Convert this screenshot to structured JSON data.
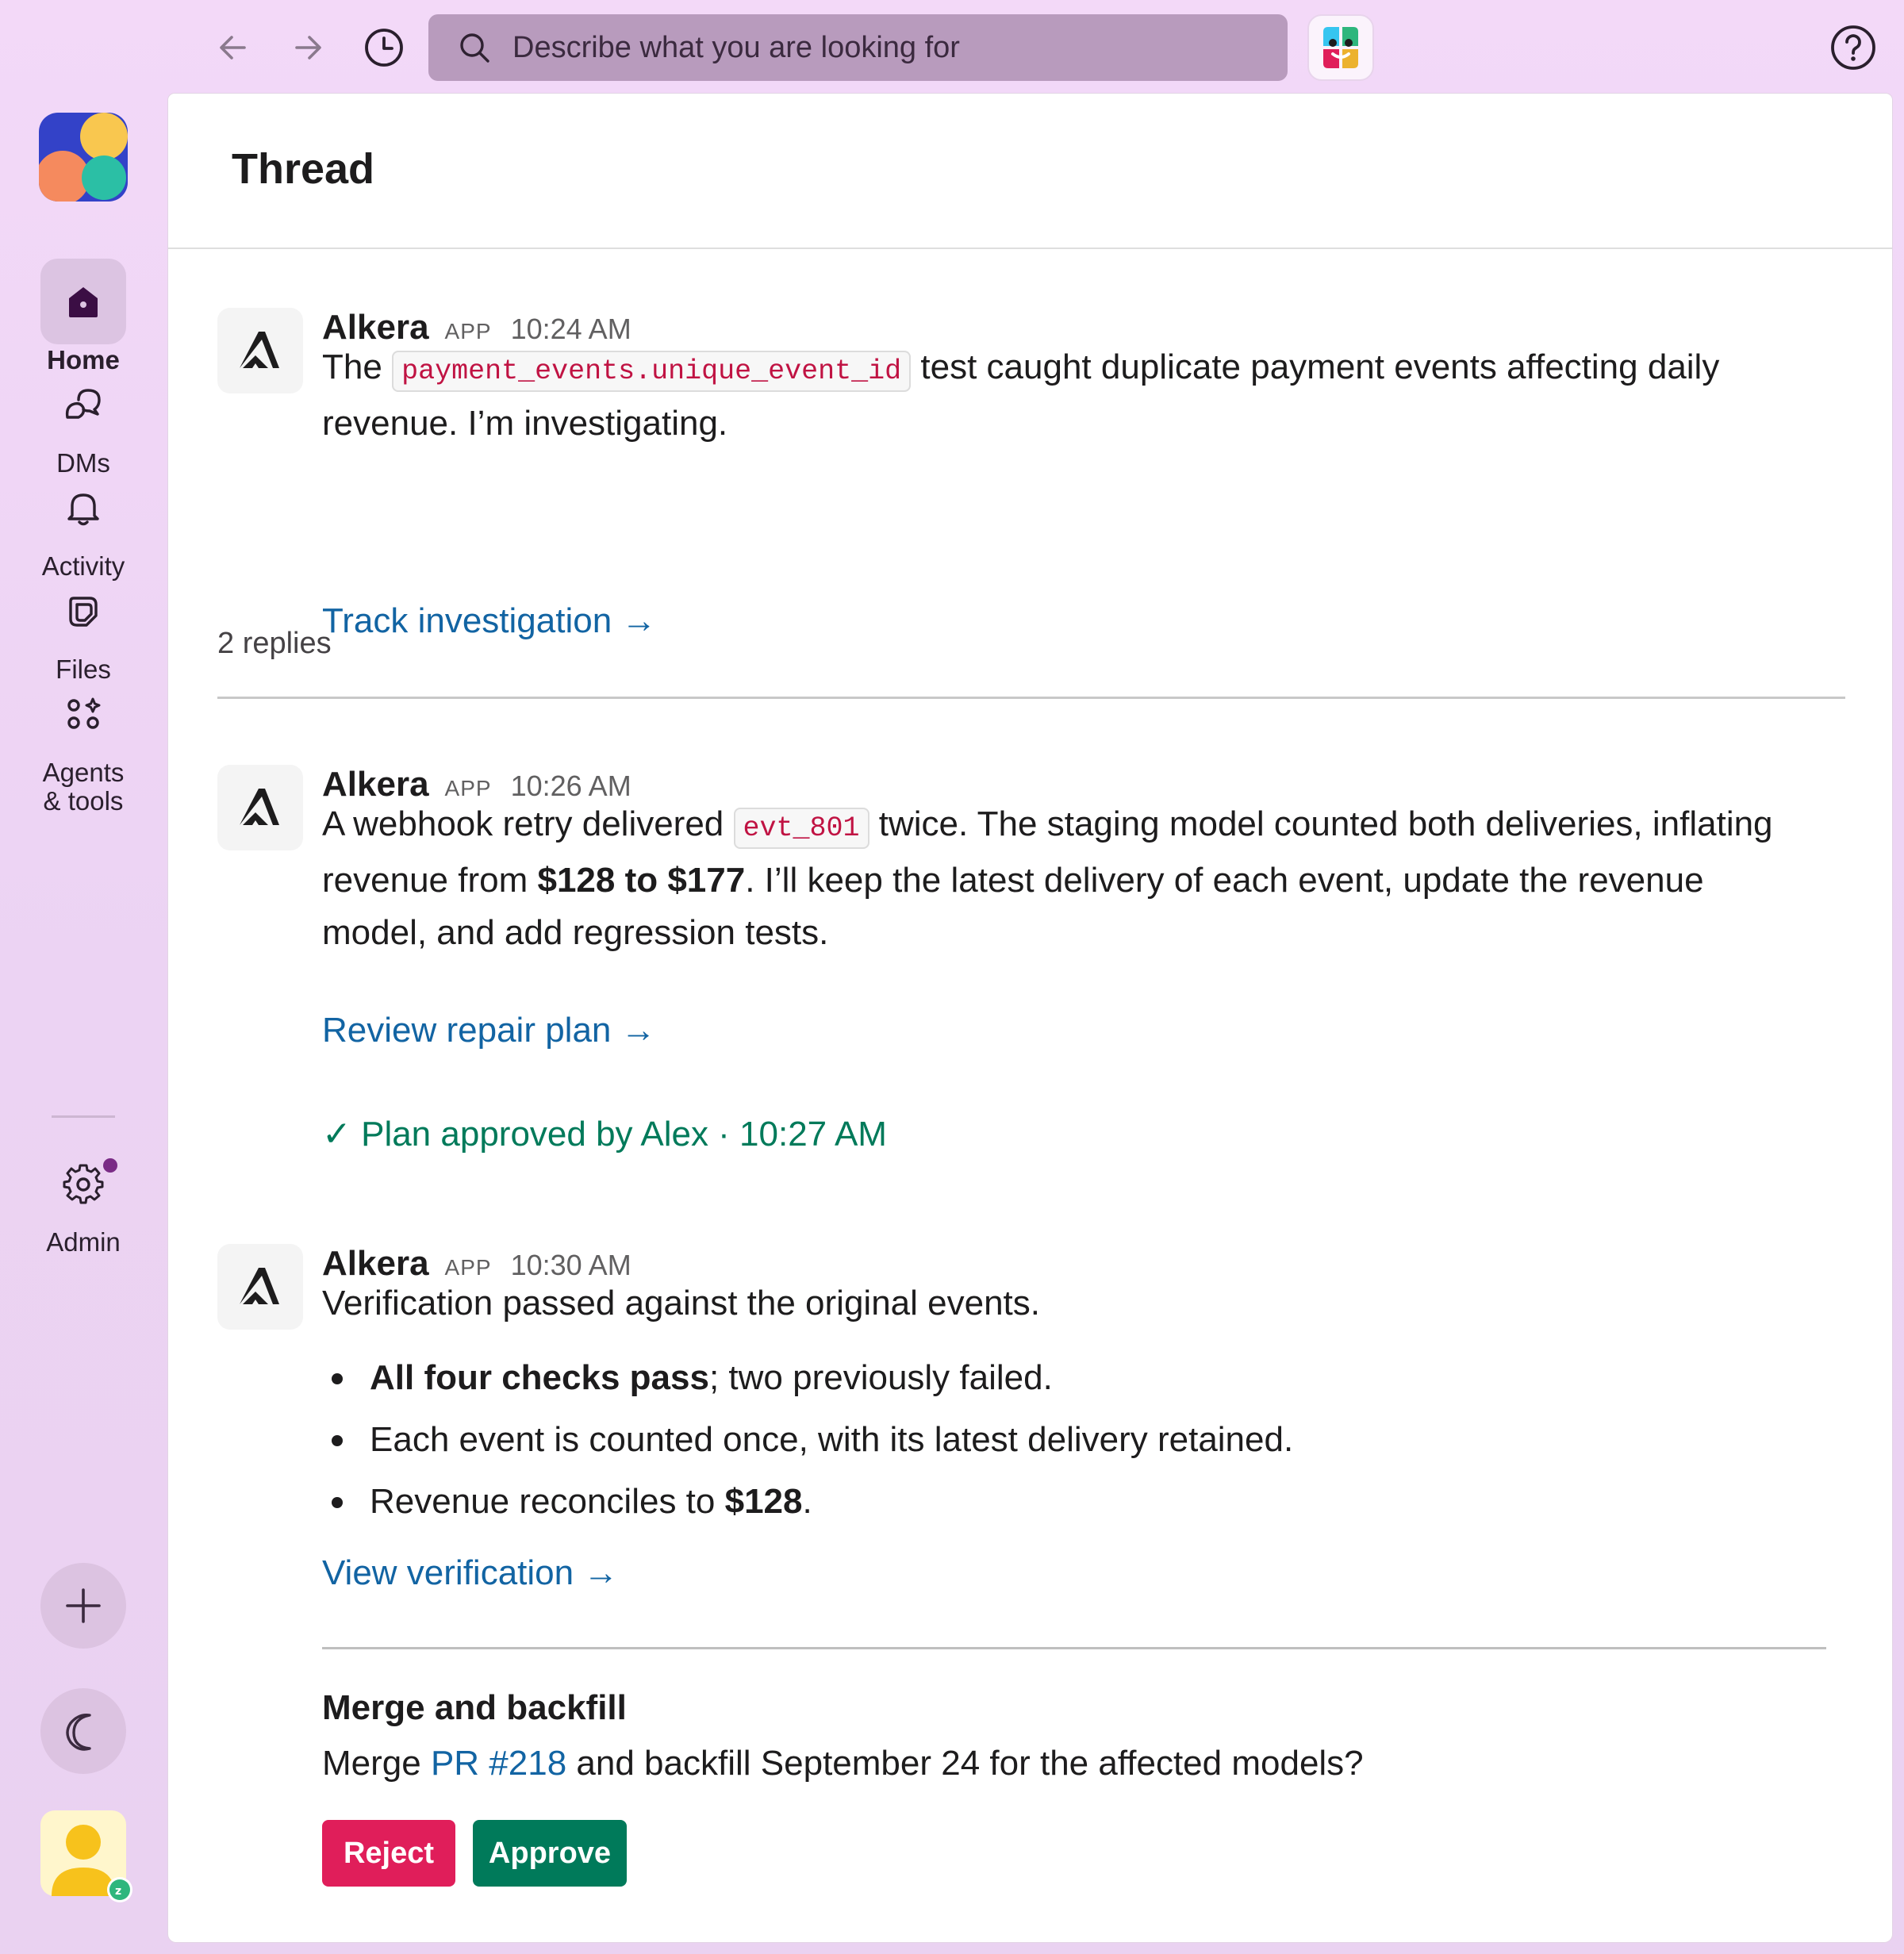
{
  "topbar": {
    "search_placeholder": "Describe what you are looking for",
    "icons": [
      "back-arrow-icon",
      "forward-arrow-icon",
      "history-clock-icon",
      "search-icon",
      "slack-ai-icon",
      "help-icon"
    ]
  },
  "sidebar": {
    "items": [
      {
        "label": "Home",
        "icon": "home-icon",
        "active": true
      },
      {
        "label": "DMs",
        "icon": "dms-icon"
      },
      {
        "label": "Activity",
        "icon": "bell-icon"
      },
      {
        "label": "Files",
        "icon": "files-icon"
      },
      {
        "label": "Agents",
        "label2": "& tools",
        "icon": "agents-tools-icon"
      },
      {
        "label": "Admin",
        "icon": "gear-icon"
      }
    ]
  },
  "thread": {
    "title": "Thread",
    "replies_label": "2 replies",
    "messages": [
      {
        "author": "Alkera",
        "badge": "APP",
        "time": "10:24 AM",
        "text_pre": "The",
        "code": "payment_events.unique_event_id",
        "text_post": "test caught duplicate payment events affecting daily",
        "text_line2": "revenue. I’m investigating.",
        "link": "Track investigation →"
      },
      {
        "author": "Alkera",
        "badge": "APP",
        "time": "10:26 AM",
        "text_pre": "A webhook retry delivered",
        "code": "evt_801",
        "text_post": "twice. The staging model counted both deliveries, inflating",
        "line2_pre": "revenue from",
        "line2_bold": "$128 to $177",
        "line2_post": ". I’ll keep the latest delivery of each event, update the revenue",
        "line3": "model, and add regression tests.",
        "link": "Review repair plan →",
        "approved": "✓ Plan approved by Alex · 10:27 AM"
      },
      {
        "author": "Alkera",
        "badge": "APP",
        "time": "10:30 AM",
        "text": "Verification passed against the original events.",
        "bullet1_bold": "All four checks pass",
        "bullet1_rest": "; two previously failed.",
        "bullet2": "Each event is counted once, with its latest delivery retained.",
        "bullet3_pre": "Revenue reconciles to",
        "bullet3_bold": "$128",
        "bullet3_post": ".",
        "link": "View verification →"
      }
    ],
    "approval": {
      "title": "Merge and backfill",
      "text_pre": "Merge",
      "pr_link": "PR #218",
      "text_post": "and backfill September 24 for the affected models?",
      "reject_label": "Reject",
      "approve_label": "Approve"
    }
  },
  "colors": {
    "link": "#1264a3",
    "approved": "#007a5a",
    "reject": "#e01e5a",
    "approve": "#007a5a",
    "code_text": "#c01343"
  }
}
